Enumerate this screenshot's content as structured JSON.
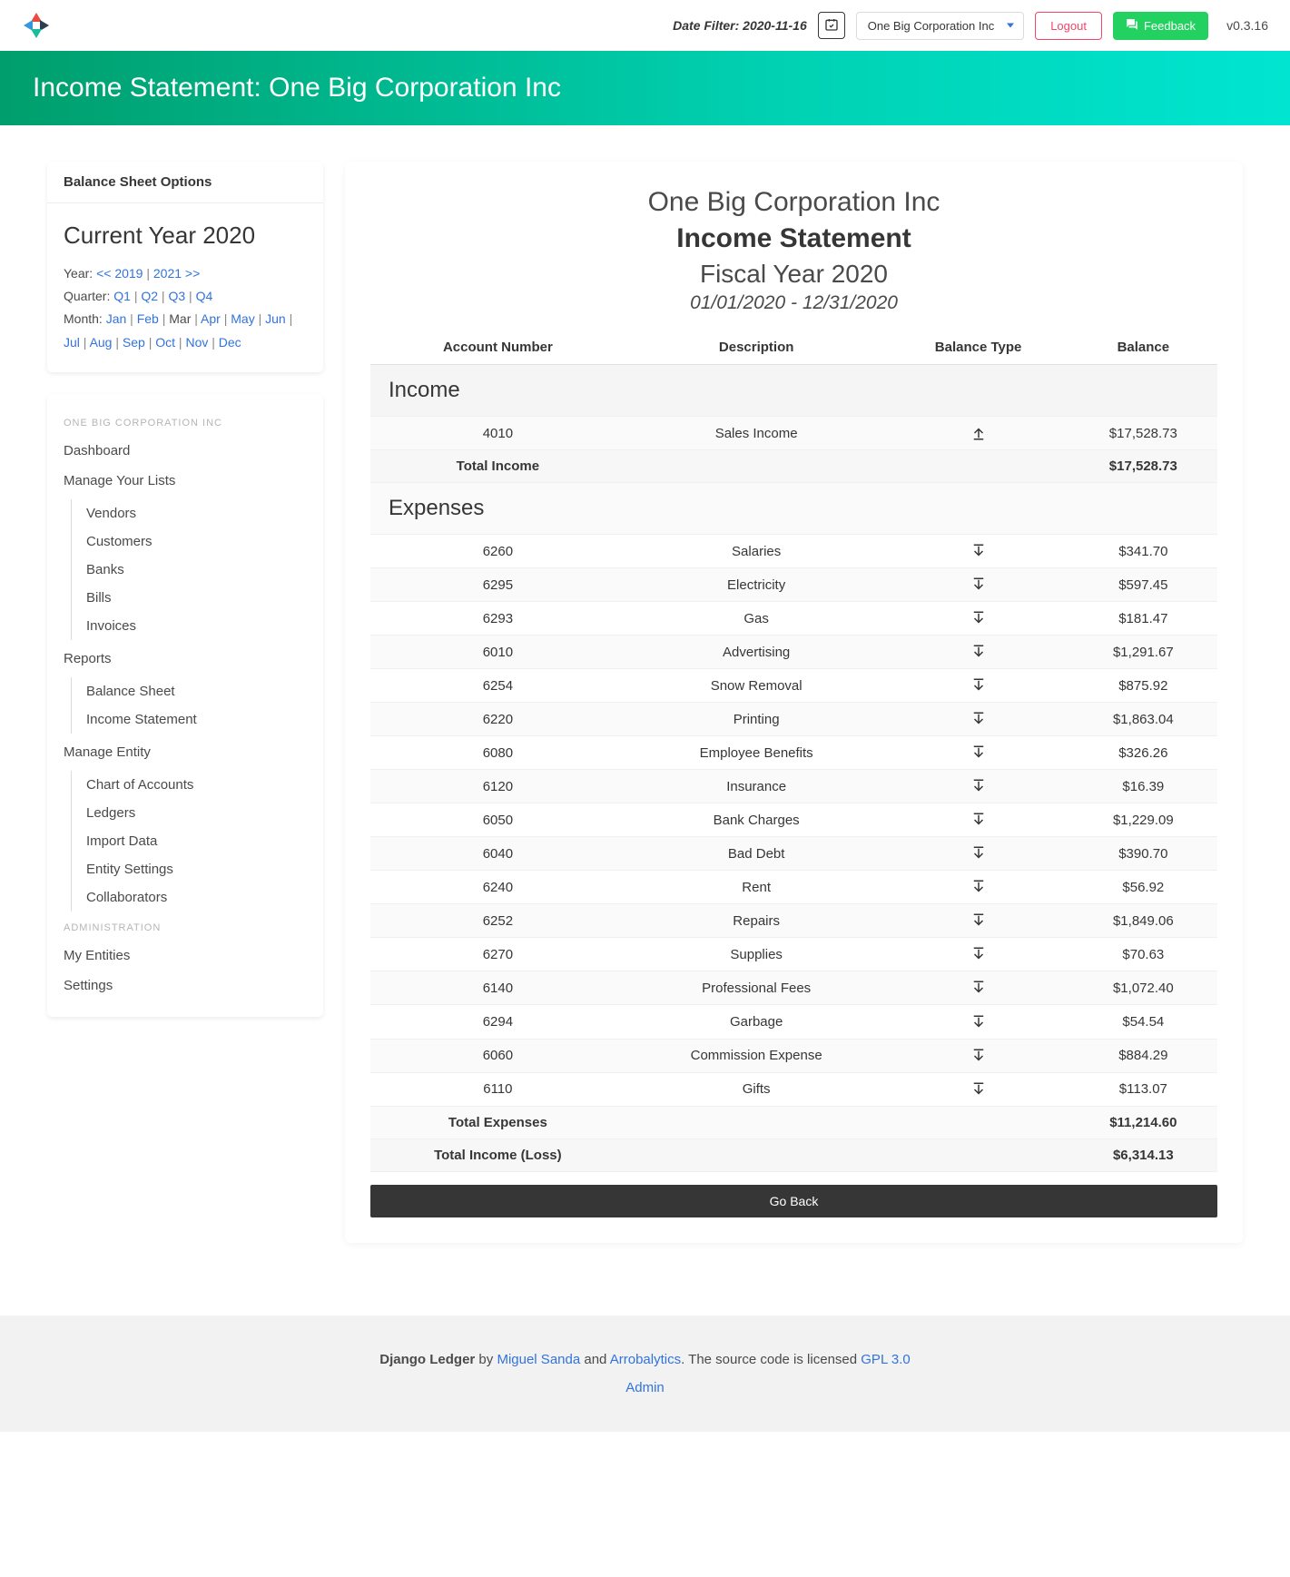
{
  "topbar": {
    "date_filter_label": "Date Filter: 2020-11-16",
    "entity_selected": "One Big Corporation Inc",
    "logout": "Logout",
    "feedback": "Feedback",
    "version": "v0.3.16"
  },
  "hero": {
    "title": "Income Statement: One Big Corporation Inc"
  },
  "options": {
    "header": "Balance Sheet Options",
    "current_year": "Current Year 2020",
    "year_label": "Year:",
    "prev_year": "<< 2019",
    "next_year": "2021 >>",
    "quarter_label": "Quarter:",
    "quarters": [
      "Q1",
      "Q2",
      "Q3",
      "Q4"
    ],
    "month_label": "Month:",
    "months_links": [
      "Jan",
      "Feb",
      "Apr",
      "May",
      "Jun",
      "Jul",
      "Aug",
      "Sep",
      "Oct",
      "Nov",
      "Dec"
    ],
    "month_plain": "Mar"
  },
  "nav": {
    "section1": "ONE BIG CORPORATION INC",
    "dashboard": "Dashboard",
    "manage_lists": "Manage Your Lists",
    "lists": [
      "Vendors",
      "Customers",
      "Banks",
      "Bills",
      "Invoices"
    ],
    "reports": "Reports",
    "reports_items": [
      "Balance Sheet",
      "Income Statement"
    ],
    "manage_entity": "Manage Entity",
    "entity_items": [
      "Chart of Accounts",
      "Ledgers",
      "Import Data",
      "Entity Settings",
      "Collaborators"
    ],
    "section2": "ADMINISTRATION",
    "my_entities": "My Entities",
    "settings": "Settings"
  },
  "report": {
    "company": "One Big Corporation Inc",
    "title": "Income Statement",
    "fiscal": "Fiscal Year 2020",
    "range": "01/01/2020 - 12/31/2020",
    "headers": [
      "Account Number",
      "Description",
      "Balance Type",
      "Balance"
    ],
    "income_section": "Income",
    "expenses_section": "Expenses",
    "income_rows": [
      {
        "acct": "4010",
        "desc": "Sales Income",
        "type": "credit",
        "bal": "$17,528.73"
      }
    ],
    "total_income_label": "Total Income",
    "total_income_value": "$17,528.73",
    "expense_rows": [
      {
        "acct": "6260",
        "desc": "Salaries",
        "type": "debit",
        "bal": "$341.70"
      },
      {
        "acct": "6295",
        "desc": "Electricity",
        "type": "debit",
        "bal": "$597.45"
      },
      {
        "acct": "6293",
        "desc": "Gas",
        "type": "debit",
        "bal": "$181.47"
      },
      {
        "acct": "6010",
        "desc": "Advertising",
        "type": "debit",
        "bal": "$1,291.67"
      },
      {
        "acct": "6254",
        "desc": "Snow Removal",
        "type": "debit",
        "bal": "$875.92"
      },
      {
        "acct": "6220",
        "desc": "Printing",
        "type": "debit",
        "bal": "$1,863.04"
      },
      {
        "acct": "6080",
        "desc": "Employee Benefits",
        "type": "debit",
        "bal": "$326.26"
      },
      {
        "acct": "6120",
        "desc": "Insurance",
        "type": "debit",
        "bal": "$16.39"
      },
      {
        "acct": "6050",
        "desc": "Bank Charges",
        "type": "debit",
        "bal": "$1,229.09"
      },
      {
        "acct": "6040",
        "desc": "Bad Debt",
        "type": "debit",
        "bal": "$390.70"
      },
      {
        "acct": "6240",
        "desc": "Rent",
        "type": "debit",
        "bal": "$56.92"
      },
      {
        "acct": "6252",
        "desc": "Repairs",
        "type": "debit",
        "bal": "$1,849.06"
      },
      {
        "acct": "6270",
        "desc": "Supplies",
        "type": "debit",
        "bal": "$70.63"
      },
      {
        "acct": "6140",
        "desc": "Professional Fees",
        "type": "debit",
        "bal": "$1,072.40"
      },
      {
        "acct": "6294",
        "desc": "Garbage",
        "type": "debit",
        "bal": "$54.54"
      },
      {
        "acct": "6060",
        "desc": "Commission Expense",
        "type": "debit",
        "bal": "$884.29"
      },
      {
        "acct": "6110",
        "desc": "Gifts",
        "type": "debit",
        "bal": "$113.07"
      }
    ],
    "total_expenses_label": "Total Expenses",
    "total_expenses_value": "$11,214.60",
    "net_label": "Total Income (Loss)",
    "net_value": "$6,314.13",
    "go_back": "Go Back"
  },
  "footer": {
    "prefix": "Django Ledger",
    "by": " by ",
    "author": "Miguel Sanda",
    "and": " and ",
    "company": "Arrobalytics",
    "license_text": ". The source code is licensed ",
    "license": "GPL 3.0",
    "admin": "Admin"
  }
}
